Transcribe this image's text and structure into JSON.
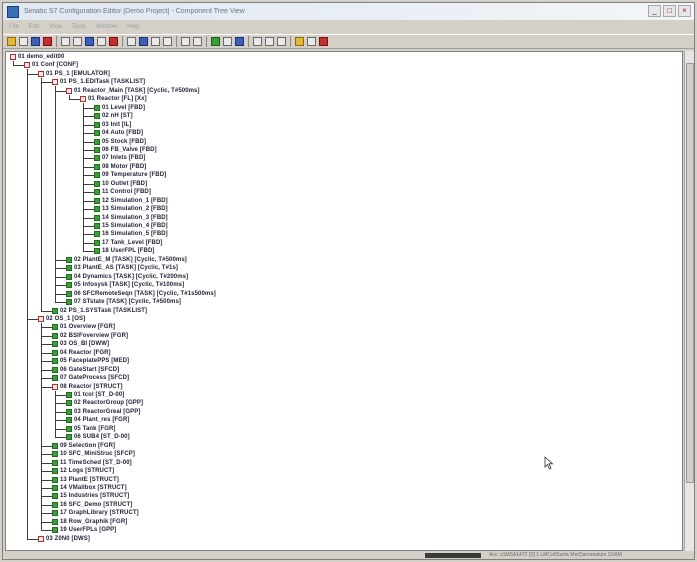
{
  "window": {
    "title": "Simatic S7 Configuration Editor [Demo Project] - Component Tree View",
    "buttons": {
      "minimize": "_",
      "maximize": "□",
      "close": "×"
    }
  },
  "menu": [
    "File",
    "Edit",
    "View",
    "Tools",
    "Window",
    "Help"
  ],
  "tree": [
    {
      "label": "01 demo_edit00",
      "depth": 0,
      "leaf": false
    },
    {
      "label": "01 Conf [CONF]",
      "depth": 1,
      "leaf": false
    },
    {
      "label": "01 PS_1 [EMULATOR]",
      "depth": 2,
      "leaf": false
    },
    {
      "label": "01 PS_1.EDITask [TASKLIST]",
      "depth": 3,
      "leaf": false
    },
    {
      "label": "01 Reactor_Main [TASK] [Cyclic, T#500ms]",
      "depth": 4,
      "leaf": false
    },
    {
      "label": "01 Reactor [FL] [Xx]",
      "depth": 5,
      "leaf": false
    },
    {
      "label": "01 Level [FBD]",
      "depth": 6,
      "leaf": true
    },
    {
      "label": "02 nH [ST]",
      "depth": 6,
      "leaf": true
    },
    {
      "label": "03 Init [IL]",
      "depth": 6,
      "leaf": true
    },
    {
      "label": "04 Auto [FBD]",
      "depth": 6,
      "leaf": true
    },
    {
      "label": "05 Stock [FBD]",
      "depth": 6,
      "leaf": true
    },
    {
      "label": "06 FB_Valve [FBD]",
      "depth": 6,
      "leaf": true
    },
    {
      "label": "07 Inlets [FBD]",
      "depth": 6,
      "leaf": true
    },
    {
      "label": "08 Motor [FBD]",
      "depth": 6,
      "leaf": true
    },
    {
      "label": "09 Temperature [FBD]",
      "depth": 6,
      "leaf": true
    },
    {
      "label": "10 Outlet [FBD]",
      "depth": 6,
      "leaf": true
    },
    {
      "label": "11 Control [FBD]",
      "depth": 6,
      "leaf": true
    },
    {
      "label": "12 Simulation_1 [FBD]",
      "depth": 6,
      "leaf": true
    },
    {
      "label": "13 Simulation_2 [FBD]",
      "depth": 6,
      "leaf": true
    },
    {
      "label": "14 Simulation_3 [FBD]",
      "depth": 6,
      "leaf": true
    },
    {
      "label": "15 Simulation_4 [FBD]",
      "depth": 6,
      "leaf": true
    },
    {
      "label": "16 Simulation_5 [FBD]",
      "depth": 6,
      "leaf": true
    },
    {
      "label": "17 Tank_Level [FBD]",
      "depth": 6,
      "leaf": true
    },
    {
      "label": "18 UserFPL [FBD]",
      "depth": 6,
      "leaf": true
    },
    {
      "label": "02 PlantE_M [TASK] [Cyclic, T#500ms]",
      "depth": 4,
      "leaf": true
    },
    {
      "label": "03 PlantE_AS [TASK] [Cyclic, T#1s]",
      "depth": 4,
      "leaf": true
    },
    {
      "label": "04 Dynamics [TASK] [Cyclic, T#200ms]",
      "depth": 4,
      "leaf": true
    },
    {
      "label": "05 Infosysk [TASK] [Cyclic, T#100ms]",
      "depth": 4,
      "leaf": true
    },
    {
      "label": "06 SFCRemoteSeqn [TASK] [Cyclic, T#1s500ms]",
      "depth": 4,
      "leaf": true
    },
    {
      "label": "07 STstate [TASK] [Cyclic, T#500ms]",
      "depth": 4,
      "leaf": true
    },
    {
      "label": "02 PS_1.SYSTask [TASKLIST]",
      "depth": 3,
      "leaf": true
    },
    {
      "label": "02 OS_1 [OS]",
      "depth": 2,
      "leaf": false
    },
    {
      "label": "01 Overview [FGR]",
      "depth": 3,
      "leaf": true
    },
    {
      "label": "02 BSIFoverview [FGR]",
      "depth": 3,
      "leaf": true
    },
    {
      "label": "03 OS_BI [DWW]",
      "depth": 3,
      "leaf": true
    },
    {
      "label": "04 Reactor [FGR]",
      "depth": 3,
      "leaf": true
    },
    {
      "label": "05 FaceplatePPS [MED]",
      "depth": 3,
      "leaf": true
    },
    {
      "label": "06 GateStart [SFCD]",
      "depth": 3,
      "leaf": true
    },
    {
      "label": "07 GateProcess [SFCD]",
      "depth": 3,
      "leaf": true
    },
    {
      "label": "08 Reactor [STRUCT]",
      "depth": 3,
      "leaf": false
    },
    {
      "label": "01 tcol [ST_D-00]",
      "depth": 4,
      "leaf": true
    },
    {
      "label": "02 ReactorGroup [GPP]",
      "depth": 4,
      "leaf": true
    },
    {
      "label": "03 ReactorGreal [GPP]",
      "depth": 4,
      "leaf": true
    },
    {
      "label": "04 Plant_res [FGR]",
      "depth": 4,
      "leaf": true
    },
    {
      "label": "05 Tank [FGR]",
      "depth": 4,
      "leaf": true
    },
    {
      "label": "06 SUB4 [ST_D-00]",
      "depth": 4,
      "leaf": true
    },
    {
      "label": "09 Selection [FGR]",
      "depth": 3,
      "leaf": true
    },
    {
      "label": "10 SFC_MiniStruc [SFCP]",
      "depth": 3,
      "leaf": true
    },
    {
      "label": "11 TimeSched [ST_D-00]",
      "depth": 3,
      "leaf": true
    },
    {
      "label": "12 Logs [STRUCT]",
      "depth": 3,
      "leaf": true
    },
    {
      "label": "13 PlantE [STRUCT]",
      "depth": 3,
      "leaf": true
    },
    {
      "label": "14 VMallbox [STRUCT]",
      "depth": 3,
      "leaf": true
    },
    {
      "label": "15 Industries [STRUCT]",
      "depth": 3,
      "leaf": true
    },
    {
      "label": "16 SFC_Demo [STRUCT]",
      "depth": 3,
      "leaf": true
    },
    {
      "label": "17 GraphLibrary [STRUCT]",
      "depth": 3,
      "leaf": true
    },
    {
      "label": "18 Row_Graphik [FGR]",
      "depth": 3,
      "leaf": true
    },
    {
      "label": "19 UserFPLs [GPP]",
      "depth": 3,
      "leaf": true
    },
    {
      "label": "03 Z0N0 [DWS]",
      "depth": 2,
      "leaf": false
    }
  ],
  "status": {
    "text": "Acc: s1MSA1472 [S] 1 LMCol/Sumk MerDanomatum SXAM"
  }
}
